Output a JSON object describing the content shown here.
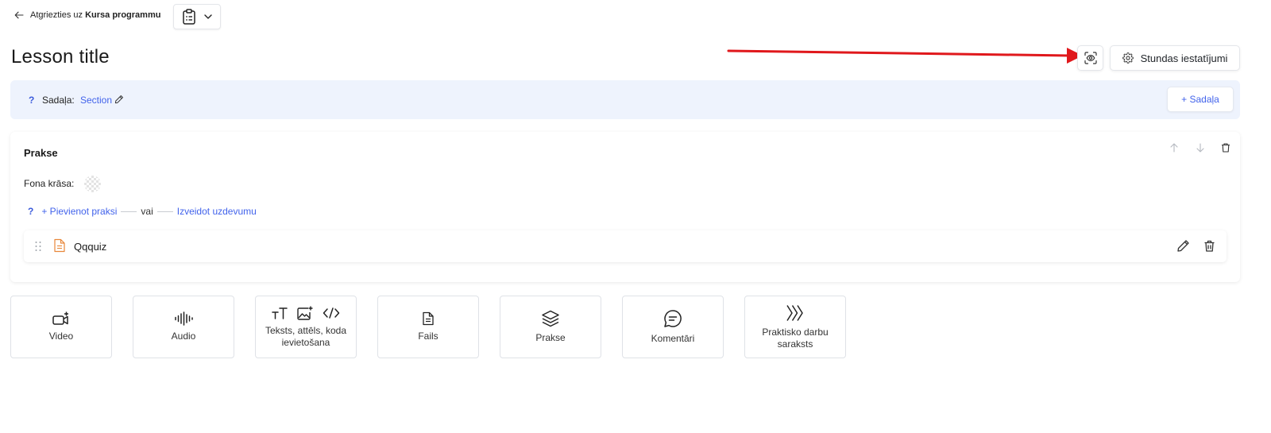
{
  "header": {
    "back_prefix": "Atgriezties uz",
    "back_target": "Kursa programmu",
    "page_title": "Lesson title",
    "settings_label": "Stundas iestatījumi"
  },
  "section": {
    "help": "?",
    "label": "Sadaļa:",
    "name": "Section",
    "add_button": "+ Sadaļa"
  },
  "practice": {
    "title": "Prakse",
    "background_label": "Fona krāsa:",
    "help": "?",
    "add_practice": "+ Pievienot praksi",
    "or": "vai",
    "create_task": "Izveidot uzdevumu",
    "items": [
      {
        "name": "Qqquiz"
      }
    ]
  },
  "tiles": [
    {
      "id": "video",
      "label": "Video"
    },
    {
      "id": "audio",
      "label": "Audio"
    },
    {
      "id": "text",
      "label": "Teksts, attēls, koda ievietošana"
    },
    {
      "id": "file",
      "label": "Fails"
    },
    {
      "id": "practice",
      "label": "Prakse"
    },
    {
      "id": "comments",
      "label": "Komentāri"
    },
    {
      "id": "practice-list",
      "label": "Praktisko darbu saraksts"
    }
  ],
  "colors": {
    "accent": "#4263eb",
    "section_bg": "#eef3fd",
    "annotation_arrow": "#e0181c",
    "file_icon": "#e8873a"
  }
}
